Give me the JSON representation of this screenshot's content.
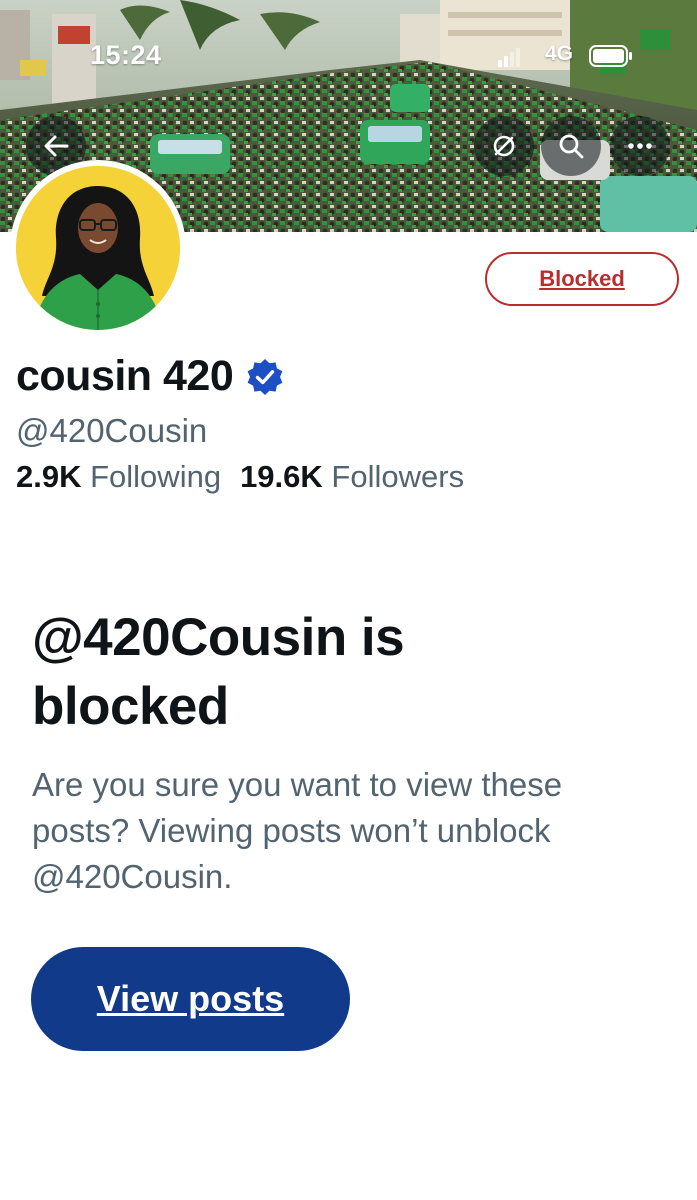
{
  "status_bar": {
    "time": "15:24",
    "network": "4G"
  },
  "nav": {
    "back_icon": "arrow-left-icon",
    "refresh_icon": "refresh-icon",
    "search_icon": "search-icon",
    "more_icon": "more-horizontal-icon"
  },
  "profile": {
    "display_name": "cousin 420",
    "verified": true,
    "handle": "@420Cousin",
    "following_count": "2.9K",
    "following_label": "Following",
    "followers_count": "19.6K",
    "followers_label": "Followers",
    "blocked_button_label": "Blocked"
  },
  "blocked_notice": {
    "title": "@420Cousin is blocked",
    "description": "Are you sure you want to view these posts? Viewing posts won’t unblock @420Cousin.",
    "view_posts_label": "View posts"
  },
  "colors": {
    "blocked_red": "#b82e2e",
    "view_posts_blue": "#123a8a",
    "verified_blue": "#1d4fc4",
    "secondary_text": "#536471"
  }
}
